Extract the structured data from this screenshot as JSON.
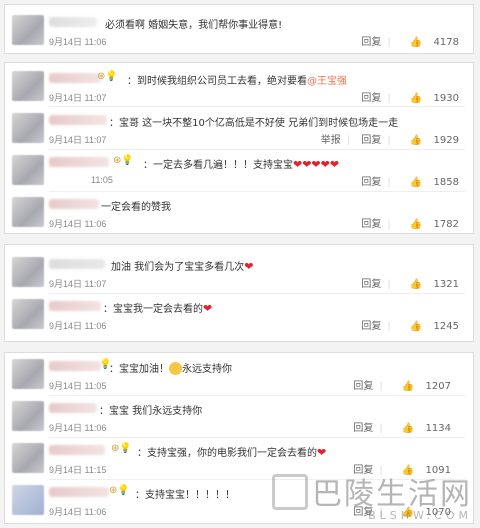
{
  "panels": [
    {
      "comments": [
        {
          "text": "必须看啊  婚姻失意，我们帮你事业得意!",
          "time": "9月14日 11:06",
          "reply": "回复",
          "likes": "4178"
        }
      ]
    },
    {
      "comments": [
        {
          "text_prefix": "：到时候我组织公司员工去看，绝对要看",
          "mention": "@王宝强",
          "time": "9月14日 11:07",
          "reply": "回复",
          "likes": "1930"
        },
        {
          "text": "：宝哥 这一块不整10个亿高低是不好使 兄弟们到时候包场走一走",
          "time": "9月14日 11:07",
          "report": "举报",
          "reply": "回复",
          "likes": "1929"
        },
        {
          "text_prefix": "：一定去多看几遍！！！支持宝宝",
          "hearts": "❤❤❤❤❤",
          "time": "11:05",
          "reply": "回复",
          "likes": "1858"
        },
        {
          "text": "一定会看的赞我",
          "time": "9月14日 11:06",
          "reply": "回复",
          "likes": "1782"
        }
      ]
    },
    {
      "comments": [
        {
          "text_prefix": "加油 我们会为了宝宝多看几次",
          "hearts": "❤",
          "time": "9月14日 11:07",
          "reply": "回复",
          "likes": "1321"
        },
        {
          "text_prefix": "：宝宝我一定会去看的",
          "hearts": "❤",
          "time": "9月14日 11:06",
          "reply": "回复",
          "likes": "1245"
        }
      ]
    },
    {
      "comments": [
        {
          "text_prefix": "：宝宝加油！",
          "text_suffix": "永远支持你",
          "time": "9月14日 11:05",
          "reply": "回复",
          "likes": "1207"
        },
        {
          "text": "：宝宝  我们永远支持你",
          "time": "9月14日 11:06",
          "reply": "回复",
          "likes": "1134"
        },
        {
          "text_prefix": "：支持宝强，你的电影我们一定会去看的",
          "hearts": "❤",
          "time": "9月14日 11:15",
          "reply": "回复",
          "likes": "1091"
        },
        {
          "text": "：支持宝宝！！！！！",
          "time": "9月14日 11:06",
          "reply": "回复",
          "likes": "1070"
        }
      ]
    }
  ],
  "like_icon": "thumbs-up-icon",
  "colors": {
    "mention": "#eb7350",
    "heart": "#e0242f",
    "panel_border": "#dcdcdc"
  },
  "watermark": {
    "cn": "巴陵生活网",
    "en": "BLSHW.COM"
  }
}
